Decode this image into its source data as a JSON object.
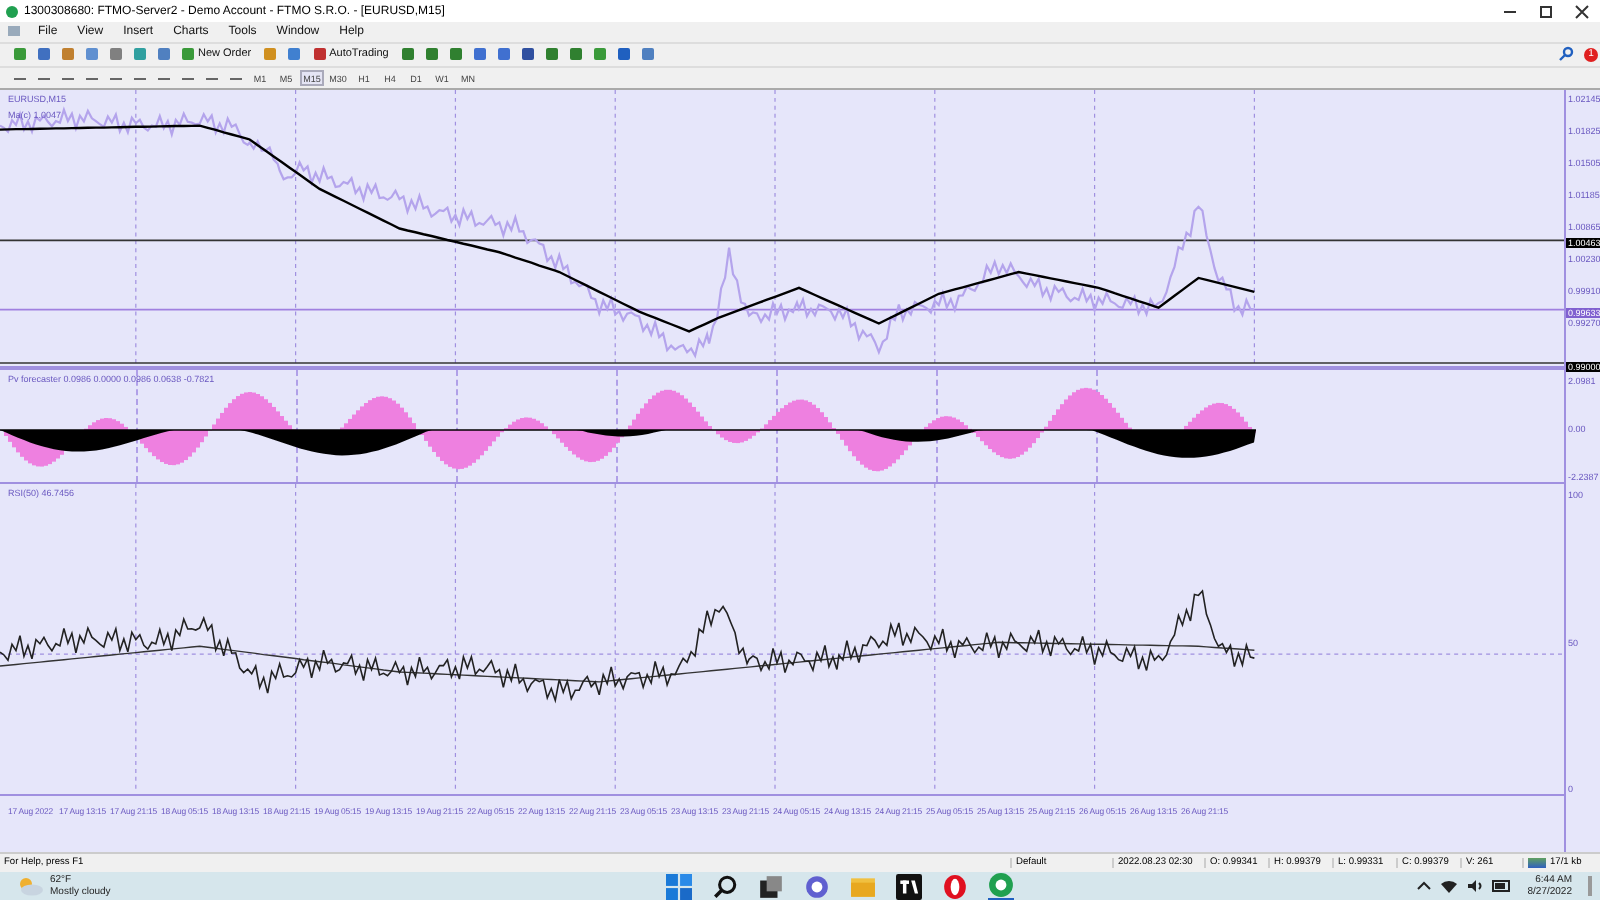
{
  "window": {
    "title": "1300308680: FTMO-Server2 - Demo Account - FTMO S.R.O. - [EURUSD,M15]"
  },
  "menu": [
    "File",
    "View",
    "Insert",
    "Charts",
    "Tools",
    "Window",
    "Help"
  ],
  "toolbar": {
    "new_order": "New Order",
    "auto_trading": "AutoTrading",
    "notification_badge": "1"
  },
  "timeframes": [
    {
      "label": "M1",
      "selected": false
    },
    {
      "label": "M5",
      "selected": false
    },
    {
      "label": "M15",
      "selected": true
    },
    {
      "label": "M30",
      "selected": false
    },
    {
      "label": "H1",
      "selected": false
    },
    {
      "label": "H4",
      "selected": false
    },
    {
      "label": "D1",
      "selected": false
    },
    {
      "label": "W1",
      "selected": false
    },
    {
      "label": "MN",
      "selected": false
    }
  ],
  "chart": {
    "symbol": "EURUSD,M15",
    "ma_label": "Ma(c) 1.0047",
    "price_ticks": [
      "1.02145",
      "1.01825",
      "1.01505",
      "1.01185",
      "1.00865",
      "1.00230",
      "0.99910",
      "0.99270"
    ],
    "price_tags": [
      {
        "value": "1.00463",
        "color": "#000000"
      },
      {
        "value": "0.99633",
        "color": "#8060d0"
      },
      {
        "value": "0.99000",
        "color": "#000000"
      }
    ],
    "forecaster_label": "Pv forecaster 0.0986 0.0000 0.0986 0.0638 -0.7821",
    "forecaster_ticks": [
      "2.0981",
      "0.00",
      "-2.2387"
    ],
    "rsi_label": "RSI(50) 46.7456",
    "rsi_ticks": [
      "100",
      "50",
      "0"
    ],
    "time_labels": [
      "17 Aug 2022",
      "17 Aug 13:15",
      "17 Aug 21:15",
      "18 Aug 05:15",
      "18 Aug 13:15",
      "18 Aug 21:15",
      "19 Aug 05:15",
      "19 Aug 13:15",
      "19 Aug 21:15",
      "22 Aug 05:15",
      "22 Aug 13:15",
      "22 Aug 21:15",
      "23 Aug 05:15",
      "23 Aug 13:15",
      "23 Aug 21:15",
      "24 Aug 05:15",
      "24 Aug 13:15",
      "24 Aug 21:15",
      "25 Aug 05:15",
      "25 Aug 13:15",
      "25 Aug 21:15",
      "26 Aug 05:15",
      "26 Aug 13:15",
      "26 Aug 21:15"
    ]
  },
  "status_bar": {
    "help": "For Help, press F1",
    "profile": "Default",
    "time": "2022.08.23 02:30",
    "open": "O: 0.99341",
    "high": "H: 0.99379",
    "low": "L: 0.99331",
    "close": "C: 0.99379",
    "volume": "V: 261",
    "traffic": "17/1 kb"
  },
  "taskbar": {
    "temperature": "62°F",
    "weather": "Mostly cloudy",
    "clock": "6:44 AM",
    "date": "8/27/2022"
  }
}
